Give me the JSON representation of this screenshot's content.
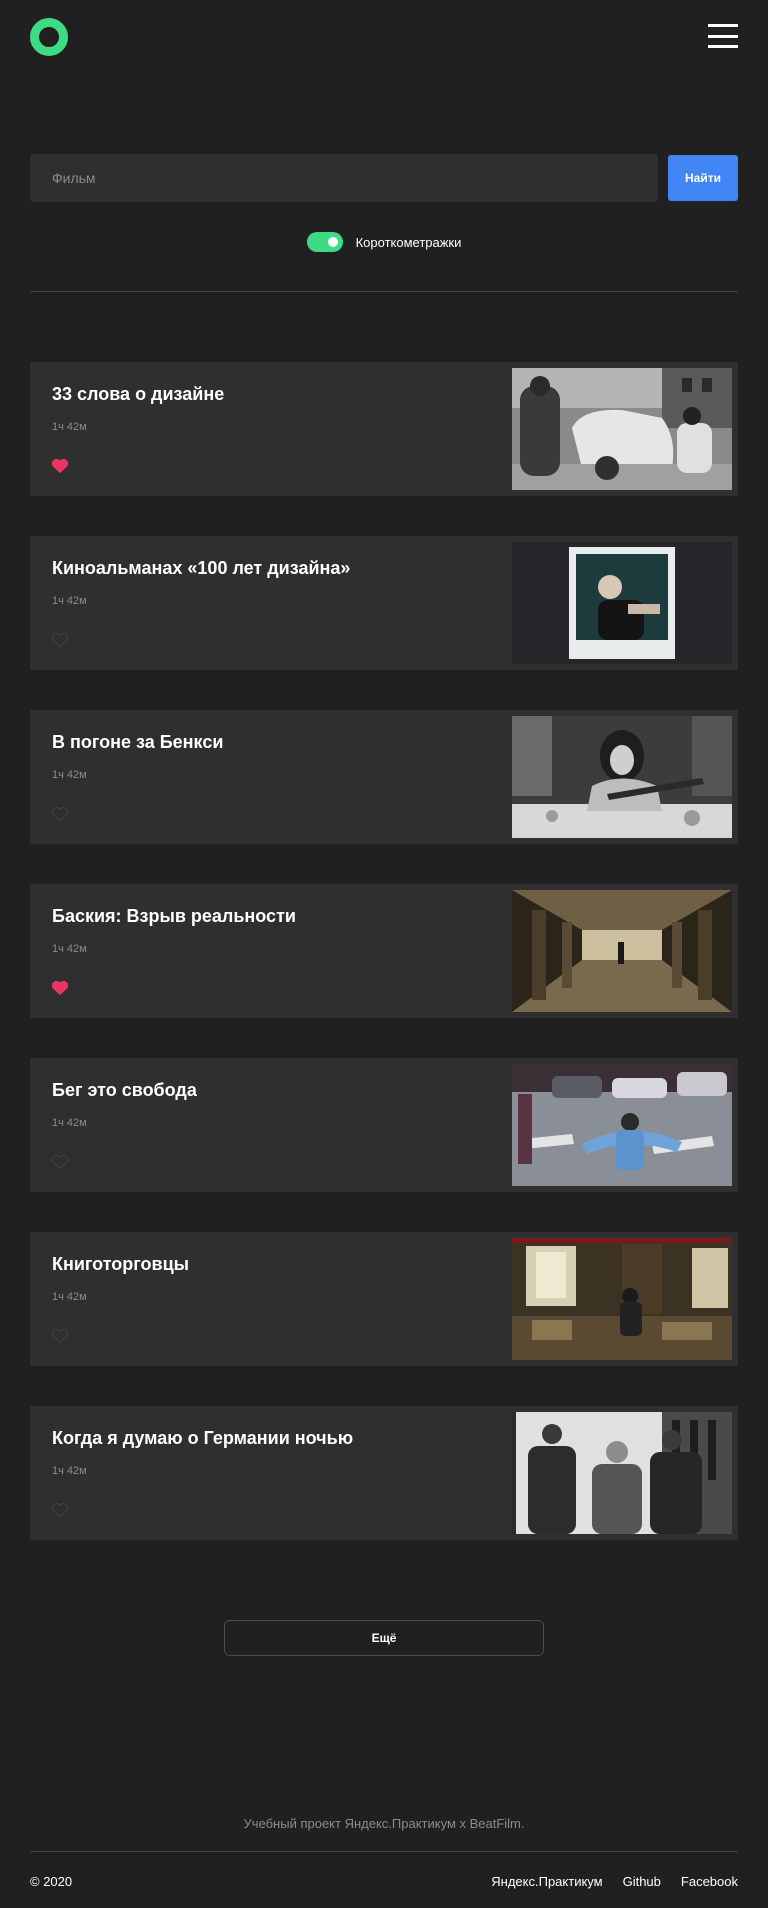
{
  "header": {
    "logo": "green-ring-logo",
    "menu_icon": "burger-menu-icon"
  },
  "search": {
    "placeholder": "Фильм",
    "value": "",
    "button_label": "Найти"
  },
  "filter": {
    "label": "Короткометражки",
    "enabled": true
  },
  "movies": [
    {
      "title": "33 слова о дизайне",
      "duration": "1ч 42м",
      "liked": true
    },
    {
      "title": "Киноальманах «100 лет дизайна»",
      "duration": "1ч 42м",
      "liked": false
    },
    {
      "title": "В погоне за Бенкси",
      "duration": "1ч 42м",
      "liked": false
    },
    {
      "title": "Баския: Взрыв реальности",
      "duration": "1ч 42м",
      "liked": true
    },
    {
      "title": "Бег это свобода",
      "duration": "1ч 42м",
      "liked": false
    },
    {
      "title": "Книготорговцы",
      "duration": "1ч 42м",
      "liked": false
    },
    {
      "title": "Когда я думаю о Германии ночью",
      "duration": "1ч 42м",
      "liked": false
    }
  ],
  "more_button_label": "Ещё",
  "footer": {
    "note": "Учебный проект Яндекс.Практикум х BeatFilm.",
    "copyright": "© 2020",
    "links": [
      "Яндекс.Практикум",
      "Github",
      "Facebook"
    ]
  },
  "colors": {
    "background": "#202020",
    "card": "#2f2f2f",
    "accent_green": "#3ddc84",
    "button_blue": "#4285f4",
    "like_active": "#ee3465",
    "like_inactive": "#424242",
    "muted_text": "#8b8b8b"
  }
}
